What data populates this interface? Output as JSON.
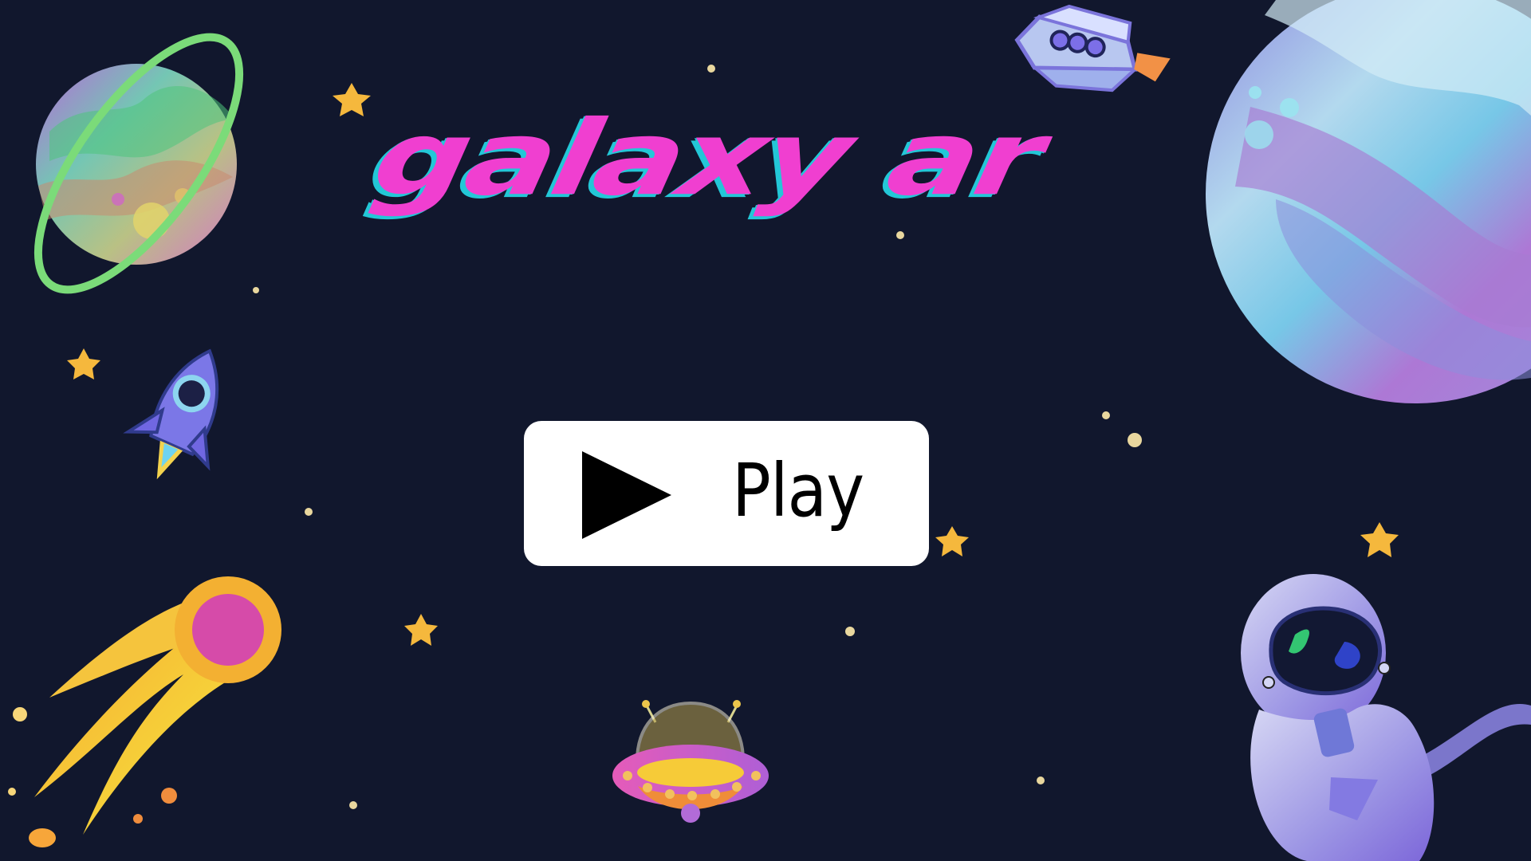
{
  "game": {
    "title": "galaxy ar",
    "play_label": "Play"
  },
  "icons": {
    "play": "play-icon",
    "decorations": [
      "ringed-planet-icon",
      "small-rocket-icon",
      "comet-icon",
      "ufo-icon",
      "spaceship-icon",
      "large-planet-icon",
      "astronaut-icon",
      "star-icon"
    ]
  },
  "colors": {
    "background": "#11172d",
    "title": "#f03fd0",
    "title_shadow": "#23c7d7",
    "button": "#ffffff",
    "button_text": "#000000",
    "star": "#f5b83d"
  }
}
